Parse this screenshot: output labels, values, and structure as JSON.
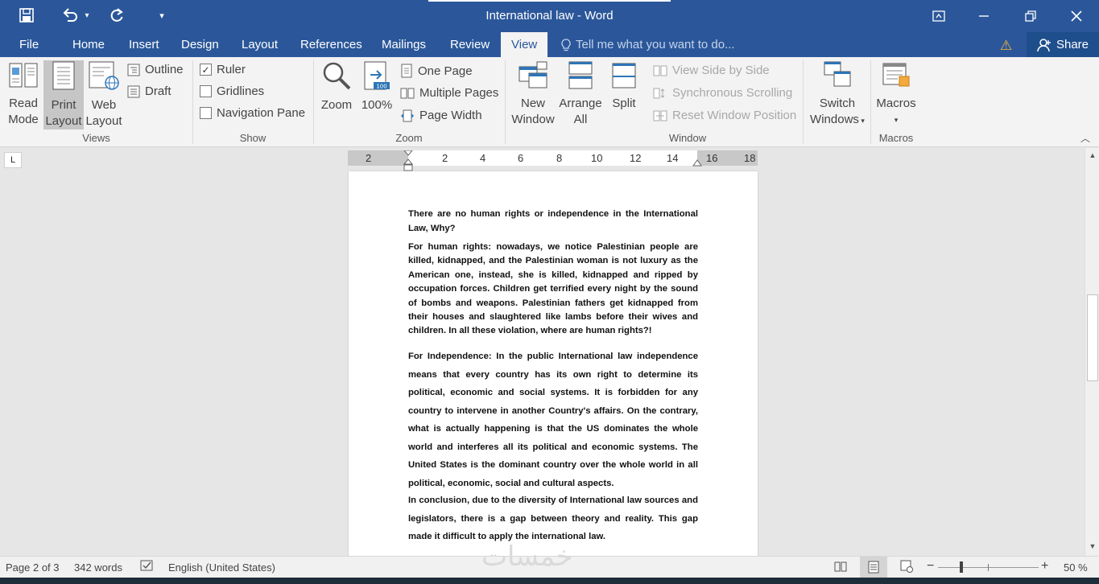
{
  "window": {
    "title": "International law - Word",
    "minimize_icon": "minimize-icon",
    "restore_icon": "restore-icon",
    "close_icon": "close-icon"
  },
  "quick_access": [
    "save-icon",
    "undo-icon",
    "redo-icon",
    "customize-icon"
  ],
  "tabs": [
    {
      "label": "File"
    },
    {
      "label": "Home"
    },
    {
      "label": "Insert"
    },
    {
      "label": "Design"
    },
    {
      "label": "Layout"
    },
    {
      "label": "References"
    },
    {
      "label": "Mailings"
    },
    {
      "label": "Review"
    },
    {
      "label": "View",
      "active": true
    }
  ],
  "tell_me": "Tell me what you want to do...",
  "share": "Share",
  "ribbon": {
    "views": {
      "label": "Views",
      "read_mode": [
        "Read",
        "Mode"
      ],
      "print_layout": [
        "Print",
        "Layout"
      ],
      "web_layout": [
        "Web",
        "Layout"
      ],
      "outline": "Outline",
      "draft": "Draft"
    },
    "show": {
      "label": "Show",
      "ruler": "Ruler",
      "ruler_checked": true,
      "gridlines": "Gridlines",
      "navigation_pane": "Navigation Pane"
    },
    "zoom": {
      "label": "Zoom",
      "zoom": "Zoom",
      "hundred": "100%",
      "one_page": "One Page",
      "multiple_pages": "Multiple Pages",
      "page_width": "Page Width"
    },
    "window": {
      "label": "Window",
      "new_window": [
        "New",
        "Window"
      ],
      "arrange_all": [
        "Arrange",
        "All"
      ],
      "split": "Split",
      "view_side_by_side": "View Side by Side",
      "synchronous_scrolling": "Synchronous Scrolling",
      "reset_window_position": "Reset Window Position",
      "switch_windows": [
        "Switch",
        "Windows"
      ]
    },
    "macros": {
      "label": "Macros",
      "macros": "Macros"
    }
  },
  "ruler": {
    "numbers": [
      "2",
      "2",
      "4",
      "6",
      "8",
      "10",
      "12",
      "14",
      "16",
      "18"
    ]
  },
  "document": {
    "p1": "There are no human rights or independence in the International Law, Why?",
    "p2": "For human rights: nowadays, we notice Palestinian people are killed, kidnapped, and the Palestinian woman is not luxury as the American one, instead, she is killed, kidnapped and ripped by occupation forces. Children get terrified every night by the sound of bombs and weapons. Palestinian fathers get kidnapped from their houses and slaughtered like lambs before their wives and children. In all these violation, where are human rights?!",
    "p3": "For Independence: In the public International law independence means that every country has its own right to determine its political, economic and social systems. It is forbidden for any country to intervene in another Country's affairs. On the contrary, what is actually happening is that the US dominates the whole world and interferes all its political and economic systems. The United States is the dominant country over the whole world in all political, economic, social and cultural aspects.",
    "p4": "In conclusion, due to the diversity of International law sources and legislators, there is a gap between theory and reality. This gap made it difficult to apply the international law."
  },
  "status": {
    "page": "Page 2 of 3",
    "words": "342 words",
    "language": "English (United States)",
    "zoom": "50 %",
    "zoom_level": 0.5
  },
  "watermark": "خمسات"
}
